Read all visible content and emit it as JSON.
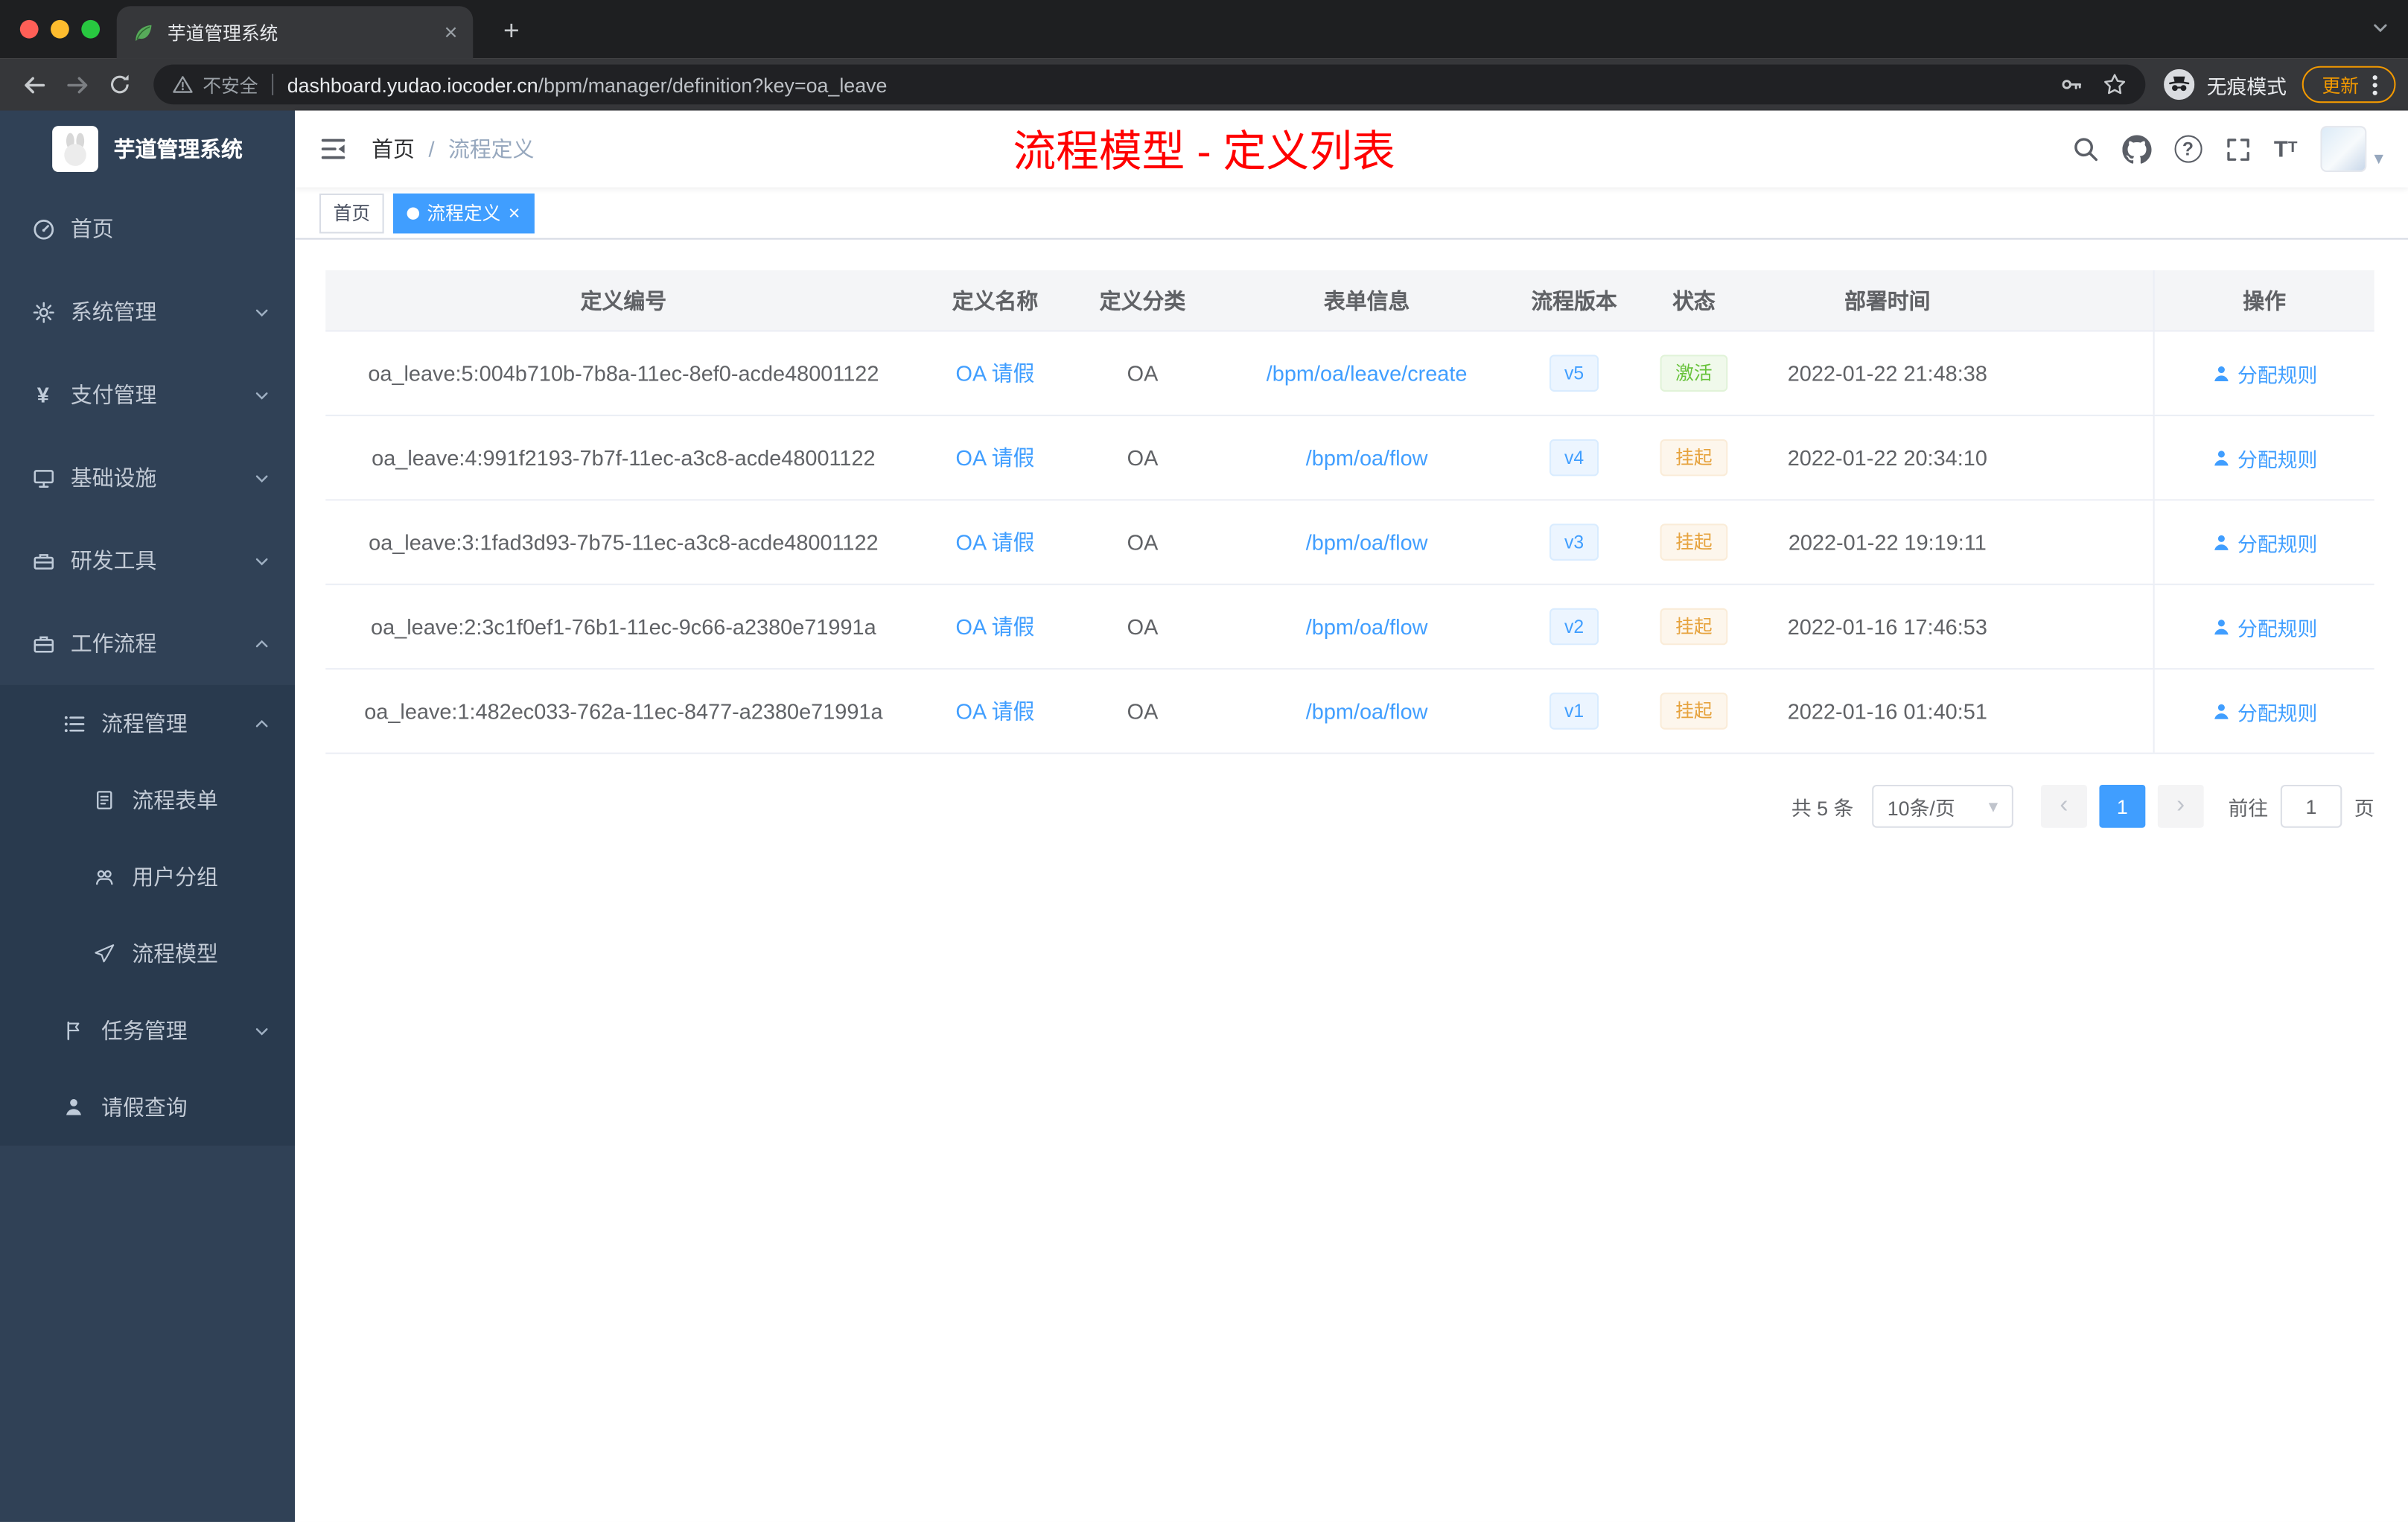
{
  "browser": {
    "tab_title": "芋道管理系统",
    "security_label": "不安全",
    "url_domain": "dashboard.yudao.iocoder.cn",
    "url_path": "/bpm/manager/definition?key=oa_leave",
    "incognito_label": "无痕模式",
    "update_label": "更新"
  },
  "sidebar": {
    "title": "芋道管理系统",
    "items": [
      {
        "label": "首页"
      },
      {
        "label": "系统管理"
      },
      {
        "label": "支付管理"
      },
      {
        "label": "基础设施"
      },
      {
        "label": "研发工具"
      },
      {
        "label": "工作流程"
      },
      {
        "label": "流程管理"
      },
      {
        "label": "流程表单"
      },
      {
        "label": "用户分组"
      },
      {
        "label": "流程模型"
      },
      {
        "label": "任务管理"
      },
      {
        "label": "请假查询"
      }
    ]
  },
  "navbar": {
    "breadcrumb": {
      "home": "首页",
      "sep": "/",
      "current": "流程定义"
    },
    "page_title": "流程模型 - 定义列表"
  },
  "tags": {
    "items": [
      {
        "label": "首页"
      },
      {
        "label": "流程定义"
      }
    ]
  },
  "table": {
    "headers": [
      "定义编号",
      "定义名称",
      "定义分类",
      "表单信息",
      "流程版本",
      "状态",
      "部署时间",
      "操作"
    ],
    "rows": [
      {
        "id": "oa_leave:5:004b710b-7b8a-11ec-8ef0-acde48001122",
        "name": "OA 请假",
        "category": "OA",
        "form": "/bpm/oa/leave/create",
        "version": "v5",
        "status": "激活",
        "time": "2022-01-22 21:48:38",
        "action": "分配规则"
      },
      {
        "id": "oa_leave:4:991f2193-7b7f-11ec-a3c8-acde48001122",
        "name": "OA 请假",
        "category": "OA",
        "form": "/bpm/oa/flow",
        "version": "v4",
        "status": "挂起",
        "time": "2022-01-22 20:34:10",
        "action": "分配规则"
      },
      {
        "id": "oa_leave:3:1fad3d93-7b75-11ec-a3c8-acde48001122",
        "name": "OA 请假",
        "category": "OA",
        "form": "/bpm/oa/flow",
        "version": "v3",
        "status": "挂起",
        "time": "2022-01-22 19:19:11",
        "action": "分配规则"
      },
      {
        "id": "oa_leave:2:3c1f0ef1-76b1-11ec-9c66-a2380e71991a",
        "name": "OA 请假",
        "category": "OA",
        "form": "/bpm/oa/flow",
        "version": "v2",
        "status": "挂起",
        "time": "2022-01-16 17:46:53",
        "action": "分配规则"
      },
      {
        "id": "oa_leave:1:482ec033-762a-11ec-8477-a2380e71991a",
        "name": "OA 请假",
        "category": "OA",
        "form": "/bpm/oa/flow",
        "version": "v1",
        "status": "挂起",
        "time": "2022-01-16 01:40:51",
        "action": "分配规则"
      }
    ]
  },
  "pagination": {
    "total": "共 5 条",
    "page_size": "10条/页",
    "page": "1",
    "goto_label": "前往",
    "goto_value": "1",
    "goto_unit": "页"
  },
  "glyphs": {
    "close": "×",
    "plus": "+",
    "caret": "▾",
    "prev": "‹",
    "next": "›",
    "yen": "¥",
    "question": "?",
    "font_big": "T",
    "font_small": "T"
  }
}
